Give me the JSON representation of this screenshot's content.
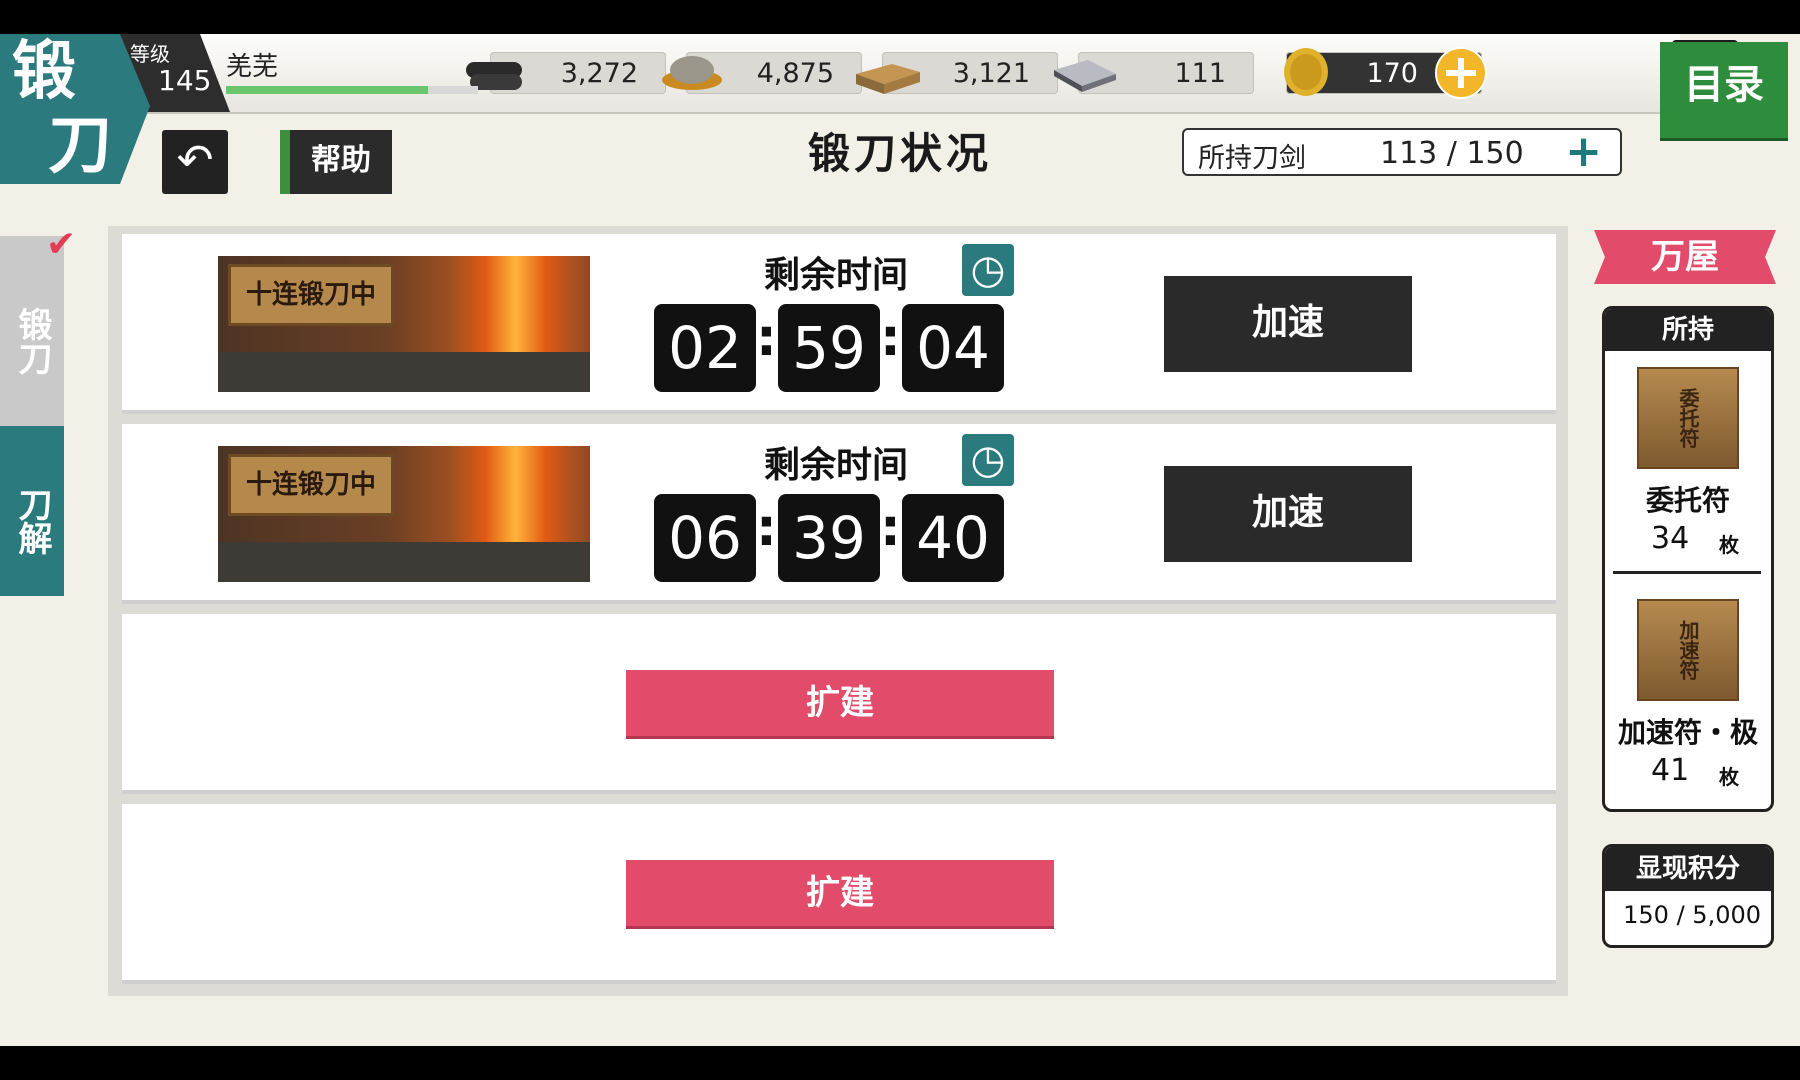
{
  "screen_title": {
    "line1": "锻",
    "line2": "刀"
  },
  "player": {
    "level_label": "等级",
    "level": "145",
    "name": "羌芜",
    "exp_fraction": 0.8
  },
  "resources": [
    {
      "icon": "charcoal-icon",
      "value": "3,272"
    },
    {
      "icon": "steel-ore-icon",
      "value": "4,875"
    },
    {
      "icon": "cooling-material-icon",
      "value": "3,121"
    },
    {
      "icon": "whetstone-icon",
      "value": "111"
    },
    {
      "icon": "koban-coin-icon",
      "value": "170"
    }
  ],
  "menu_label": "目录",
  "help_label": "帮助",
  "page_title": "锻刀状况",
  "sword_count": {
    "label": "所持刀剑",
    "value": "113 / 150"
  },
  "tabs": [
    {
      "label": "锻刀",
      "active": true
    },
    {
      "label": "刀解",
      "active": false
    }
  ],
  "slots": [
    {
      "status_sign": "十连锻刀中",
      "timer_label": "剩余时间",
      "h": "02",
      "m": "59",
      "s": "04",
      "button": "加速"
    },
    {
      "status_sign": "十连锻刀中",
      "timer_label": "剩余时间",
      "h": "06",
      "m": "39",
      "s": "40",
      "button": "加速"
    },
    {
      "button": "扩建"
    },
    {
      "button": "扩建"
    }
  ],
  "shop_label": "万屋",
  "owned": {
    "title": "所持",
    "items": [
      {
        "icon_text": "委托符",
        "name": "委托符",
        "count": "34",
        "unit": "枚"
      },
      {
        "icon_text": "加速符",
        "name": "加速符・极",
        "count": "41",
        "unit": "枚"
      }
    ]
  },
  "points": {
    "title": "显现积分",
    "value": "150 / 5,000"
  },
  "colors": {
    "teal": "#2b7a7e",
    "pink": "#e24b6a",
    "green": "#2e8d3d"
  }
}
